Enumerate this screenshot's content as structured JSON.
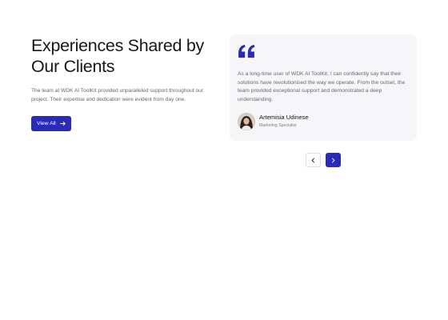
{
  "section": {
    "title": "Experiences Shared by Our Clients",
    "description": "The team at WDK AI ToolKit provided unparalleled support throughout our project. Their expertise and dedication were evident from day one.",
    "view_all_label": "View All"
  },
  "testimonial": {
    "text": "As a long-time user of WDK AI ToolKit, I can confidently say that their solutions have revolutionised the way we operate. From the outset, the team provided exceptional support and demonstrated a deep understanding.",
    "name": "Artemisia Udinese",
    "role": "Marketing Specialist"
  },
  "icons": {
    "quote": "quote-icon",
    "arrow": "arrow-right-icon",
    "prev": "chevron-left-icon",
    "next": "chevron-right-icon"
  },
  "colors": {
    "accent": "#2a2ab8",
    "card_bg": "#f6f6f8"
  }
}
